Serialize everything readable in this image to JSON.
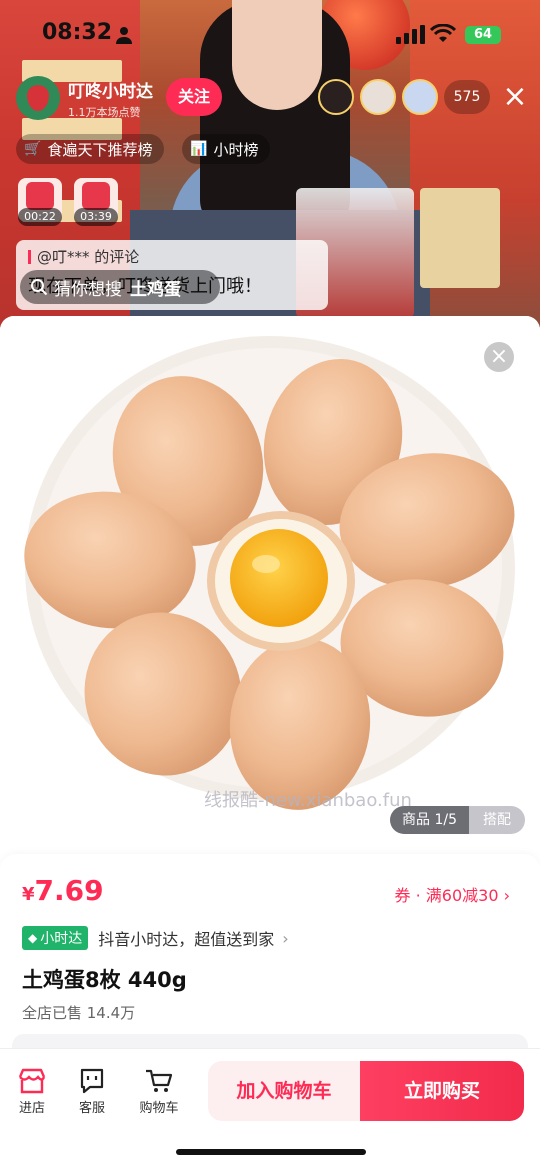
{
  "status_bar": {
    "time": "08:32",
    "battery": "64"
  },
  "live": {
    "streamer_name": "叮咚小时达",
    "likes": "1.1万本场点赞",
    "follow_label": "关注",
    "viewer_count": "575",
    "rank_pills": [
      {
        "icon": "🛒",
        "label": "食遍天下推荐榜"
      },
      {
        "icon": "📊",
        "label": "小时榜"
      }
    ],
    "red_packets": [
      {
        "timer": "00:22"
      },
      {
        "timer": "03:39"
      }
    ],
    "comment_header": "@叮*** 的评论",
    "comment_text": "现在下单，叮咚送货上门哦！",
    "search_prefix": "猜你想搜",
    "search_keyword": "土鸡蛋"
  },
  "product": {
    "watermark": "线报酷-new.xianbao.fun",
    "image_tab_product": "商品 1/5",
    "image_tab_match": "搭配",
    "currency": "¥",
    "price": "7.69",
    "coupon": "券 · 满60减30",
    "tag_label": "小时达",
    "tag_desc": "抖音小时达，超值送到家",
    "title": "土鸡蛋8枚 440g",
    "sold": "全店已售 14.4万"
  },
  "bottom_bar": {
    "nav": [
      {
        "label": "进店",
        "icon": "store-icon"
      },
      {
        "label": "客服",
        "icon": "chat-icon"
      },
      {
        "label": "购物车",
        "icon": "cart-icon"
      }
    ],
    "add_to_cart": "加入购物车",
    "buy_now": "立即购买"
  },
  "colors": {
    "accent": "#fe2c55",
    "tag_green": "#20b46a"
  }
}
